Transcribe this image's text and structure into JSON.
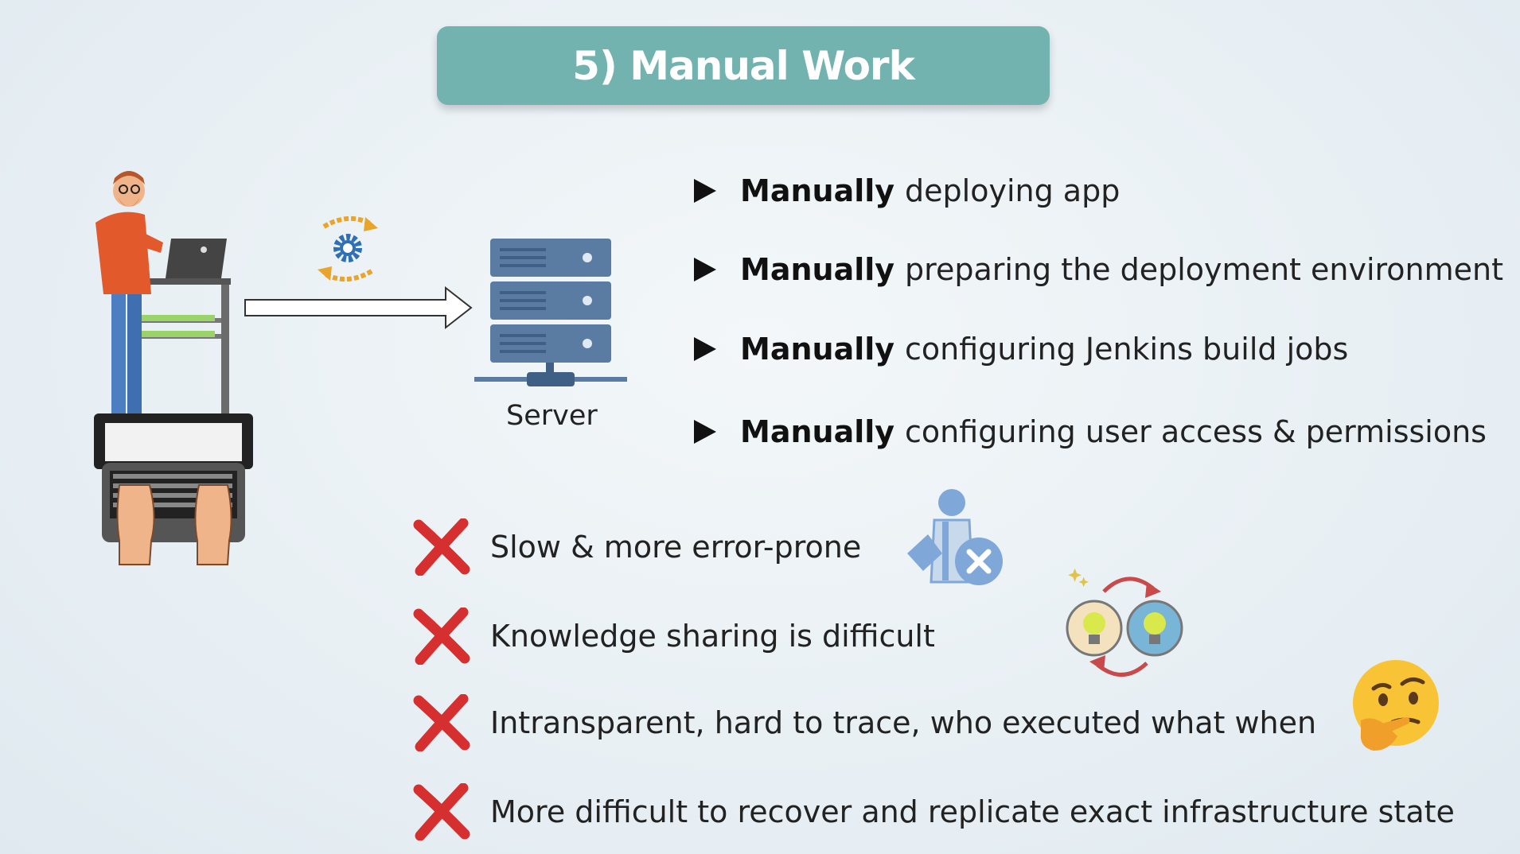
{
  "title": "5) Manual Work",
  "server_label": "Server",
  "bullets": [
    {
      "bold": "Manually",
      "text": "deploying app"
    },
    {
      "bold": "Manually",
      "text": "preparing the deployment environment"
    },
    {
      "bold": "Manually",
      "text": "configuring Jenkins build jobs"
    },
    {
      "bold": "Manually",
      "text": "configuring user access & permissions"
    }
  ],
  "cons": [
    "Slow & more error-prone",
    "Knowledge sharing is difficult",
    "Intransparent, hard to trace, who executed what when",
    "More difficult to recover and replicate exact infrastructure state"
  ],
  "colors": {
    "title_bg": "#72b2af",
    "cross": "#d62f2f"
  },
  "icons": [
    "developer-illustration",
    "gear-cycle-icon",
    "arrow-right-icon",
    "server-icon",
    "user-error-icon",
    "idea-exchange-icon",
    "thinking-face-icon",
    "cross-icon"
  ]
}
